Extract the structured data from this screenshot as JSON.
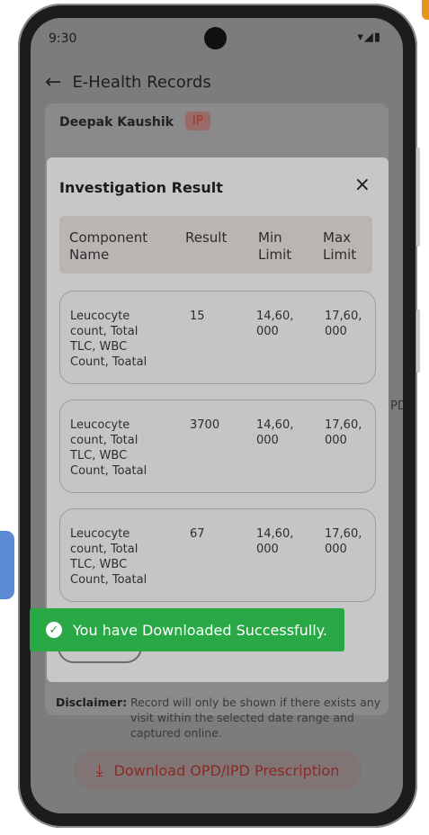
{
  "status_bar": {
    "time": "9:30",
    "icons": "▾◢▮"
  },
  "app_bar": {
    "back_icon": "arrow-left-icon",
    "title": "E-Health Records"
  },
  "patient": {
    "name": "Deepak Kaushik",
    "badge": "IP"
  },
  "peek_text": "PD",
  "modal": {
    "title": "Investigation Result",
    "close_icon": "×",
    "columns": [
      {
        "line1": "Component",
        "line2": "Name"
      },
      {
        "line1": "Result",
        "line2": ""
      },
      {
        "line1": "Min",
        "line2": "Limit"
      },
      {
        "line1": "Max",
        "line2": "Limit"
      }
    ],
    "rows": [
      {
        "name_lines": [
          "Leucocyte",
          "count, Total",
          "TLC, WBC",
          "Count, Toatal"
        ],
        "result": "15",
        "min_lines": [
          "14,60,",
          "000"
        ],
        "max_lines": [
          "17,60,",
          "000"
        ]
      },
      {
        "name_lines": [
          "Leucocyte",
          "count, Total",
          "TLC, WBC",
          "Count, Toatal"
        ],
        "result": "3700",
        "min_lines": [
          "14,60,",
          "000"
        ],
        "max_lines": [
          "17,60,",
          "000"
        ]
      },
      {
        "name_lines": [
          "Leucocyte",
          "count, Total",
          "TLC, WBC",
          "Count, Toatal"
        ],
        "result": "67",
        "min_lines": [
          "14,60,",
          "000"
        ],
        "max_lines": [
          "17,60,",
          "000"
        ]
      }
    ]
  },
  "toast": {
    "message": "You have Downloaded Successfully.",
    "icon": "✓"
  },
  "disclaimer": {
    "label": "Disclaimer:",
    "text": "Record will only be shown if there exists any visit within the selected date range and captured online."
  },
  "download_button": {
    "label": "Download OPD/IPD Prescription",
    "icon": "⤓"
  },
  "colors": {
    "toast_green": "#29a846",
    "accent_red": "#8b2b24"
  }
}
